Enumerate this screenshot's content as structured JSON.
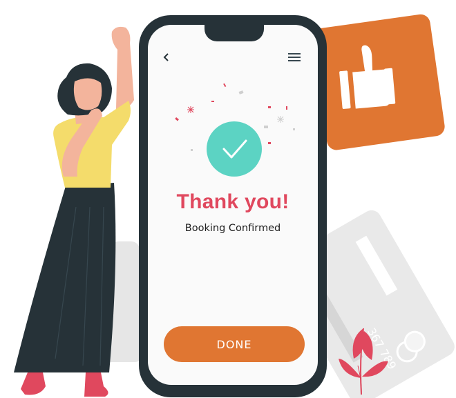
{
  "screen": {
    "title": "Thank you!",
    "subtitle": "Booking Confirmed",
    "done_label": "DONE"
  },
  "icons": {
    "back": "chevron-left",
    "menu": "hamburger-menu",
    "status": "checkmark",
    "card": "thumbs-up"
  },
  "colors": {
    "accent": "#e07632",
    "title": "#e0485e",
    "check_badge": "#5cd3c3",
    "phone_frame": "#263238"
  }
}
